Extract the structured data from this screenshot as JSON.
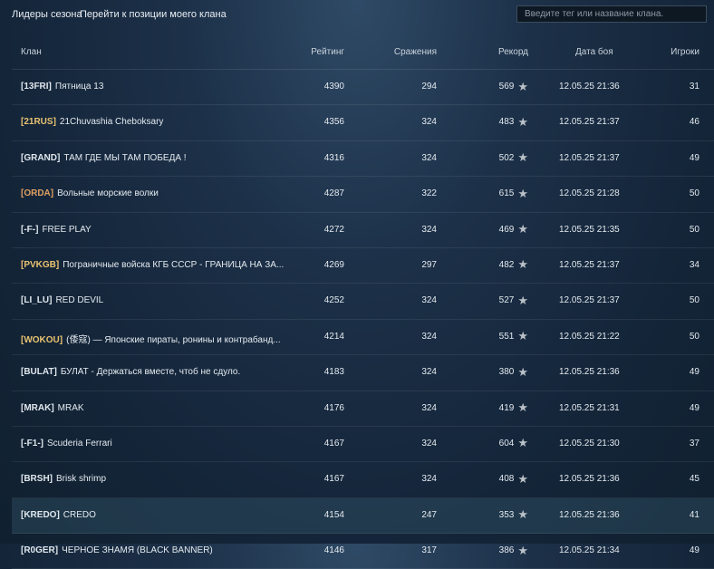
{
  "nav": {
    "leaders_label": "Лидеры сезона",
    "goto_label": "Перейти к позиции моего клана"
  },
  "search": {
    "placeholder": "Введите тег или название клана."
  },
  "columns": {
    "clan": "Клан",
    "rating": "Рейтинг",
    "battles": "Сражения",
    "record": "Рекорд",
    "date": "Дата боя",
    "players": "Игроки"
  },
  "rows": [
    {
      "tag": "[13FRI]",
      "name": "Пятница 13",
      "rating": "4390",
      "battles": "294",
      "record": "569",
      "date": "12.05.25 21:36",
      "players": "31",
      "tag_color": "white"
    },
    {
      "tag": "[21RUS]",
      "name": "21Chuvashia Cheboksary",
      "rating": "4356",
      "battles": "324",
      "record": "483",
      "date": "12.05.25 21:37",
      "players": "46",
      "tag_color": "gold"
    },
    {
      "tag": "[GRAND]",
      "name": "ТАМ ГДЕ МЫ ТАМ ПОБЕДА !",
      "rating": "4316",
      "battles": "324",
      "record": "502",
      "date": "12.05.25 21:37",
      "players": "49",
      "tag_color": "white"
    },
    {
      "tag": "[ORDA]",
      "name": "Вольные морские волки",
      "rating": "4287",
      "battles": "322",
      "record": "615",
      "date": "12.05.25 21:28",
      "players": "50",
      "tag_color": "orange"
    },
    {
      "tag": "[-F-]",
      "name": "FREE PLAY",
      "rating": "4272",
      "battles": "324",
      "record": "469",
      "date": "12.05.25 21:35",
      "players": "50",
      "tag_color": "white"
    },
    {
      "tag": "[PVKGB]",
      "name": "Пограничные войска КГБ СССР - ГРАНИЦА НА ЗА...",
      "rating": "4269",
      "battles": "297",
      "record": "482",
      "date": "12.05.25 21:37",
      "players": "34",
      "tag_color": "gold"
    },
    {
      "tag": "[LI_LU]",
      "name": "RED DEVIL",
      "rating": "4252",
      "battles": "324",
      "record": "527",
      "date": "12.05.25 21:37",
      "players": "50",
      "tag_color": "white"
    },
    {
      "tag": "[WOKOU]",
      "name": "(倭寇) — Японские пираты, ронины и контрабанд...",
      "rating": "4214",
      "battles": "324",
      "record": "551",
      "date": "12.05.25 21:22",
      "players": "50",
      "tag_color": "gold"
    },
    {
      "tag": "[BULAT]",
      "name": "БУЛАТ - Держаться вместе, чтоб не сдуло.",
      "rating": "4183",
      "battles": "324",
      "record": "380",
      "date": "12.05.25 21:36",
      "players": "49",
      "tag_color": "white"
    },
    {
      "tag": "[MRAK]",
      "name": "MRAK",
      "rating": "4176",
      "battles": "324",
      "record": "419",
      "date": "12.05.25 21:31",
      "players": "49",
      "tag_color": "white"
    },
    {
      "tag": "[-F1-]",
      "name": "Scuderia Ferrari",
      "rating": "4167",
      "battles": "324",
      "record": "604",
      "date": "12.05.25 21:30",
      "players": "37",
      "tag_color": "white"
    },
    {
      "tag": "[BRSH]",
      "name": "Brisk shrimp",
      "rating": "4167",
      "battles": "324",
      "record": "408",
      "date": "12.05.25 21:36",
      "players": "45",
      "tag_color": "white"
    },
    {
      "tag": "[KREDO]",
      "name": "CREDO",
      "rating": "4154",
      "battles": "247",
      "record": "353",
      "date": "12.05.25 21:36",
      "players": "41",
      "tag_color": "white",
      "highlighted": true
    },
    {
      "tag": "[R0GER]",
      "name": "ЧЕРНОЕ ЗНАМЯ (BLACK BANNER)",
      "rating": "4146",
      "battles": "317",
      "record": "386",
      "date": "12.05.25 21:34",
      "players": "49",
      "tag_color": "white"
    }
  ],
  "icons": {
    "record_icon": "star-icon"
  }
}
